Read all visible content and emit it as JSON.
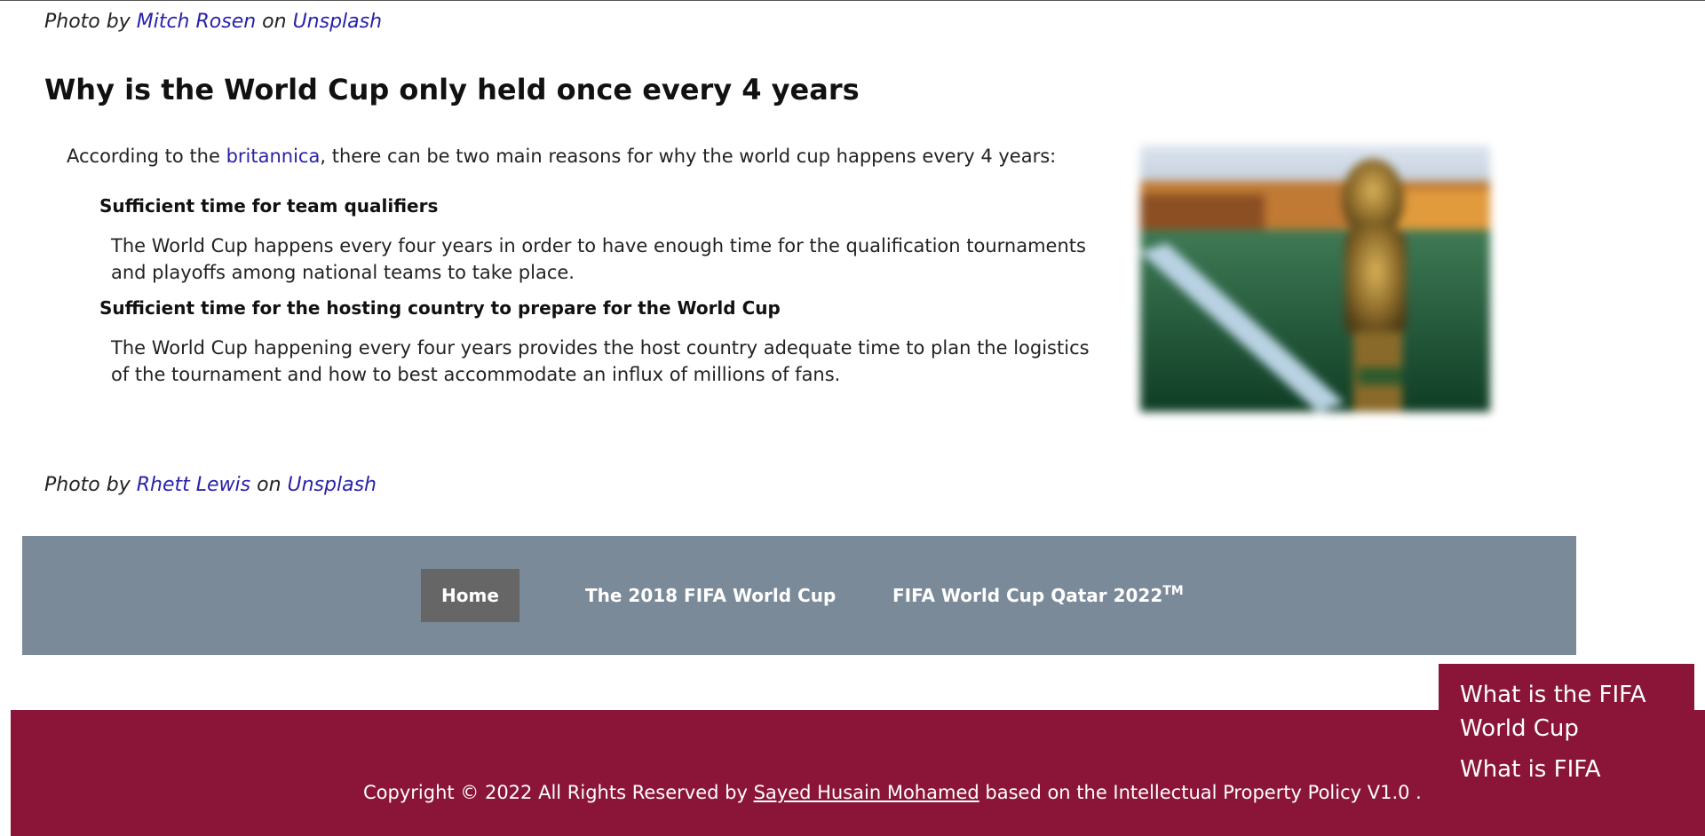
{
  "photo_credit_top": {
    "prefix": "Photo by ",
    "author": "Mitch Rosen",
    "middle": " on ",
    "site": "Unsplash"
  },
  "section": {
    "title": "Why is the World Cup only held once every 4 years",
    "intro_prefix": "According to the ",
    "intro_link": "britannica",
    "intro_suffix": ", there can be two main reasons for why the world cup happens every 4 years:",
    "reasons": [
      {
        "heading": "Sufficient time for team qualifiers",
        "body": "The World Cup happens every four years in order to have enough time for the qualification tournaments and playoffs among national teams to take place."
      },
      {
        "heading": "Sufficient time for the hosting country to prepare for the World Cup",
        "body": "The World Cup happening every four years provides the host country adequate time to plan the logistics of the tournament and how to best accommodate an influx of millions of fans."
      }
    ]
  },
  "photo_credit_bottom": {
    "prefix": "Photo by ",
    "author": "Rhett Lewis",
    "middle": " on ",
    "site": "Unsplash"
  },
  "nav": {
    "home": "Home",
    "wc2018": "The 2018 FIFA World Cup",
    "qatar": "FIFA World Cup Qatar 2022",
    "qatar_sup": "TM"
  },
  "footer": {
    "prefix": "Copyright © 2022 All Rights Reserved by ",
    "author": "Sayed Husain Mohamed",
    "suffix": " based on the Intellectual Property Policy V1.0 ."
  },
  "side_menu": {
    "items": [
      "What is the FIFA World Cup",
      "What is FIFA"
    ]
  },
  "colors": {
    "link": "#2a22a8",
    "nav_bg": "#7a8a98",
    "nav_active": "#666666",
    "footer_bg": "#8a1538"
  }
}
